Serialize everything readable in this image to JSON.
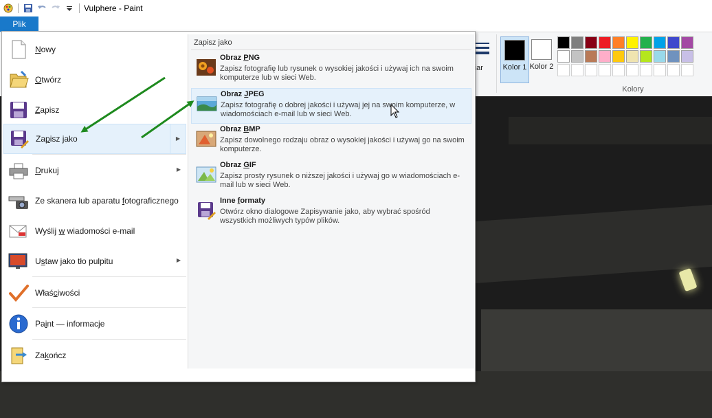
{
  "window": {
    "title": "Vulphere - Paint"
  },
  "ribbon": {
    "file_tab": "Plik",
    "resize_partial": "zmiar",
    "color1_label": "Kolor 1",
    "color2_label": "Kolor 2",
    "colors_group": "Kolory",
    "palette_row1": [
      "#000000",
      "#7f7f7f",
      "#880015",
      "#ed1c24",
      "#ff7f27",
      "#fff200",
      "#22b14c",
      "#00a2e8",
      "#3f48cc",
      "#a349a4"
    ],
    "palette_row2": [
      "#ffffff",
      "#c3c3c3",
      "#b97a57",
      "#ffaec9",
      "#ffc90e",
      "#efe4b0",
      "#b5e61d",
      "#99d9ea",
      "#7092be",
      "#c8bfe7"
    ]
  },
  "file_menu": {
    "items": [
      {
        "label": "Nowy",
        "icon": "new-document-icon"
      },
      {
        "label": "Otwórz",
        "icon": "open-folder-icon"
      },
      {
        "label": "Zapisz",
        "icon": "save-disk-icon"
      },
      {
        "label": "Zapisz jako",
        "icon": "save-as-icon"
      },
      {
        "label": "Drukuj",
        "icon": "printer-icon"
      },
      {
        "label": "Ze skanera lub aparatu fotograficznego",
        "icon": "scanner-camera-icon"
      },
      {
        "label": "Wyślij w wiadomości e-mail",
        "icon": "email-icon"
      },
      {
        "label": "Ustaw jako tło pulpitu",
        "icon": "desktop-background-icon"
      },
      {
        "label": "Właściwości",
        "icon": "checkmark-icon"
      },
      {
        "label": "Paint — informacje",
        "icon": "info-icon"
      },
      {
        "label": "Zakończ",
        "icon": "exit-icon"
      }
    ],
    "submenu_title": "Zapisz jako",
    "submenu": [
      {
        "title": "Obraz PNG",
        "desc": "Zapisz fotografię lub rysunek o wysokiej jakości i używaj ich na swoim komputerze lub w sieci Web."
      },
      {
        "title": "Obraz JPEG",
        "desc": "Zapisz fotografię o dobrej jakości i używaj jej na swoim komputerze, w wiadomościach e-mail lub w sieci Web."
      },
      {
        "title": "Obraz BMP",
        "desc": "Zapisz dowolnego rodzaju obraz o wysokiej jakości i używaj go na swoim komputerze."
      },
      {
        "title": "Obraz GIF",
        "desc": "Zapisz prosty rysunek o niższej jakości i używaj go w wiadomościach e-mail lub w sieci Web."
      },
      {
        "title": "Inne formaty",
        "desc": "Otwórz okno dialogowe Zapisywanie jako, aby wybrać spośród wszystkich możliwych typów plików."
      }
    ]
  },
  "colors": {
    "accent": "#1979ca",
    "highlight": "#e5f1fb",
    "annotation_arrow": "#1e8a1e"
  }
}
